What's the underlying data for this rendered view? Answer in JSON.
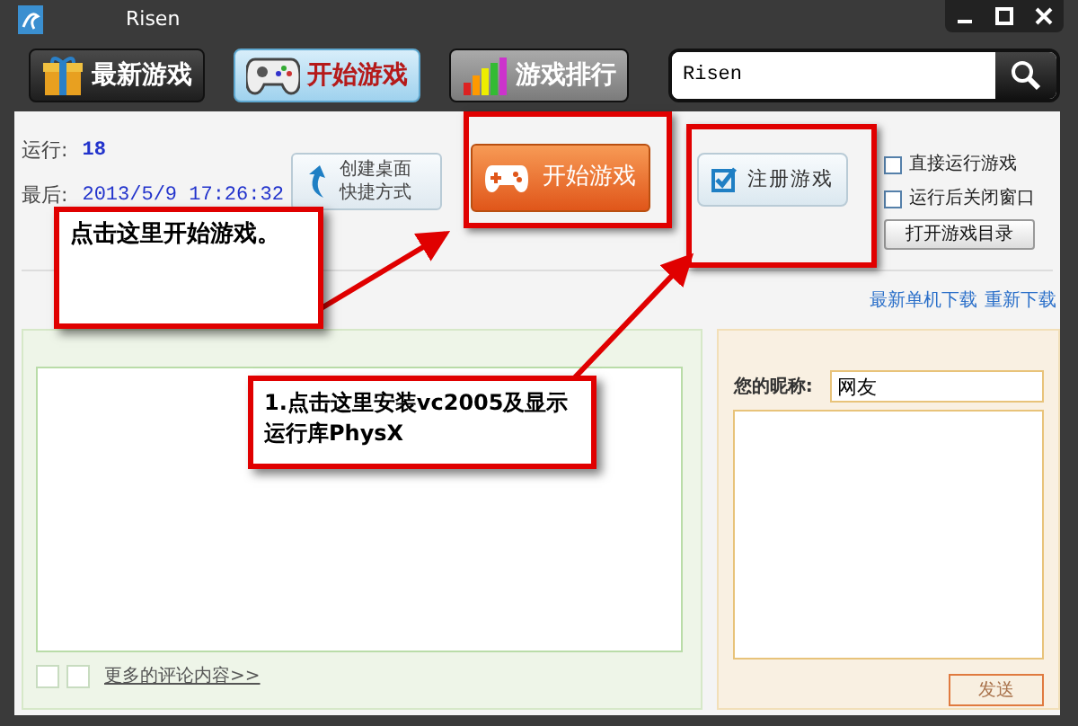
{
  "window": {
    "title": "Risen"
  },
  "tabs": [
    {
      "label": "最新游戏",
      "selected": false,
      "kind": "gift"
    },
    {
      "label": "开始游戏",
      "selected": true,
      "kind": "gamepad"
    },
    {
      "label": "游戏排行",
      "selected": false,
      "kind": "chart"
    }
  ],
  "search": {
    "value": "Risen"
  },
  "stats": [
    {
      "label": "运行:",
      "value": "18"
    },
    {
      "label": "最后:",
      "value": "2013/5/9 17:26:32"
    }
  ],
  "shortcut_button": {
    "lines": [
      "创建桌面",
      "快捷方式"
    ]
  },
  "start_button": {
    "label": "开始游戏"
  },
  "register_button": {
    "label": "注册游戏"
  },
  "options": [
    {
      "label": "直接运行游戏",
      "checked": false
    },
    {
      "label": "运行后关闭窗口",
      "checked": false
    }
  ],
  "open_folder_button": {
    "label": "打开游戏目录"
  },
  "links": [
    "最新单机下载",
    "重新下载"
  ],
  "comments": {
    "more_link": "更多的评论内容>>"
  },
  "reply": {
    "nickname_label": "您的昵称:",
    "nickname": "网友",
    "send_button": "发送"
  },
  "annotations": [
    {
      "text": "点击这里开始游戏。"
    },
    {
      "text": "1.点击这里安装vc2005及显示运行库PhysX"
    }
  ]
}
